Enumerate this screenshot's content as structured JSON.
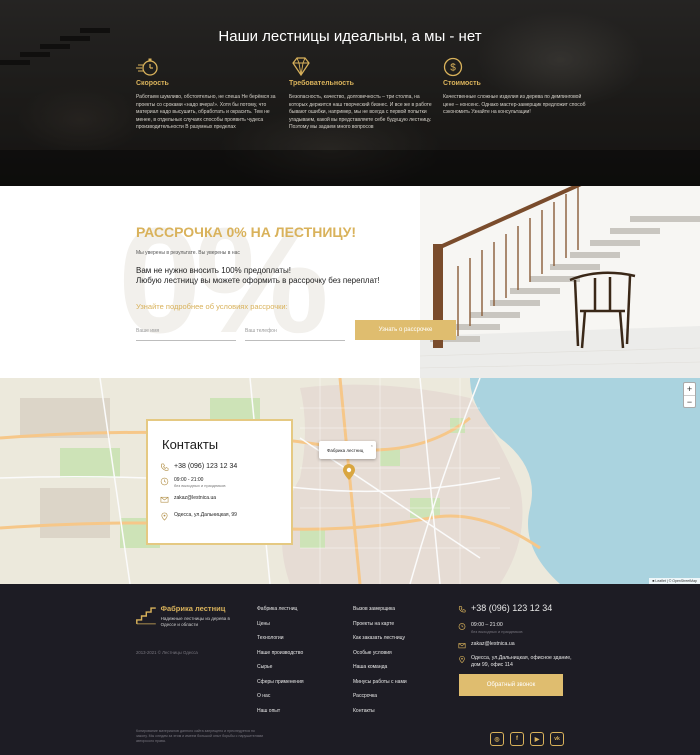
{
  "hero": {
    "title": "Наши лестницы идеальны, а мы - нет",
    "features": [
      {
        "icon": "stopwatch-icon",
        "title": "Скорость",
        "text": "Работаем шумливо, обстоятельно, не спеша Не берёмся за проекты со сроками «надо вчера!». Хотя бы потому, что материал надо высушить, обработать и окрасить. Тем не менее, в отдельных случаях способы проявить чудеса производительности В разумных пределах"
      },
      {
        "icon": "diamond-icon",
        "title": "Требовательность",
        "text": "Безопасность, качество, долговечность – три столпа, на которых держится наш творческий бизнес. И все же в работе бывают ошибки, например, мы не всегда с первой попытки угадываем, какой вы представляете себе будущую лестницу. Поэтому мы задаем много вопросов"
      },
      {
        "icon": "dollar-coin-icon",
        "title": "Стоимость",
        "text": "Качественные сложные изделия из дерева по демпинговой цене – нонсенс. Однако мастер-замерщик предложит способ сэкономить Узнайте на консультации!"
      }
    ]
  },
  "promo": {
    "bg_text": "0%",
    "title": "РАССРОЧКА 0% НА ЛЕСТНИЦУ!",
    "subtitle": "Мы уверены в результате. Вы уверены в нас",
    "lead_1": "Вам не нужно вносить 100% предоплаты!",
    "lead_2": "Любую лестницу вы можете оформить в рассрочку без переплат!",
    "learn_more": "Узнайте подробнее об условиях рассрочки:",
    "name_placeholder": "Ваше имя",
    "phone_placeholder": "Ваш телефон",
    "button": "Узнать о рассрочке"
  },
  "map": {
    "zoom_in": "+",
    "zoom_out": "−",
    "popup_label": "Фабрика лестниц",
    "popup_close": "×",
    "attribution": "■ Leaflet | © OpenStreetMap",
    "contacts": {
      "title": "Контакты",
      "phone": "+38 (096) 123 12 34",
      "hours": "09:00 - 21:00",
      "hours_note": "без выходных и праздников",
      "email": "zakaz@lestnica.ua",
      "address": "Одесса, ул.Дальницкая, 99"
    }
  },
  "footer": {
    "brand": "Фабрика лестниц",
    "slogan": "Надежные лестницы из дерева в Одессе и области",
    "copyright": "2013-2021 © Лестницы Одесса",
    "col1": [
      "Фабрика лестниц",
      "Цены",
      "Технологии",
      "Наше производство",
      "Сырье",
      "Сферы применения",
      "О нас",
      "Наш опыт"
    ],
    "col2": [
      "Вызов замерщика",
      "Проекты на карте",
      "Как заказать лестницу",
      "Особые условия",
      "Наша команда",
      "Минусы работы с нами",
      "Рассрочка",
      "Контакты"
    ],
    "phone": "+38 (096) 123 12 34",
    "hours": "09:00 – 21:00",
    "hours_note": "без выходных и праздников",
    "email": "zakaz@lestnica.ua",
    "address": "Одесса, ул.Дальницкая, офисное здание, дом 99, офис 114",
    "callback_button": "Обратный звонок",
    "legal": "Копирование материалов данного сайта запрещено и преследуется по закону. Мы следим за этим и имеем большой опыт борьбы с нарушителями авторского права.",
    "social": [
      {
        "icon": "instagram-icon",
        "glyph": "◎"
      },
      {
        "icon": "facebook-icon",
        "glyph": "f"
      },
      {
        "icon": "youtube-icon",
        "glyph": "▶"
      },
      {
        "icon": "vk-icon",
        "glyph": "vk"
      }
    ]
  },
  "colors": {
    "accent": "#d9b25b",
    "footer_bg": "#1d1c24",
    "button": "#dfbd6f"
  }
}
